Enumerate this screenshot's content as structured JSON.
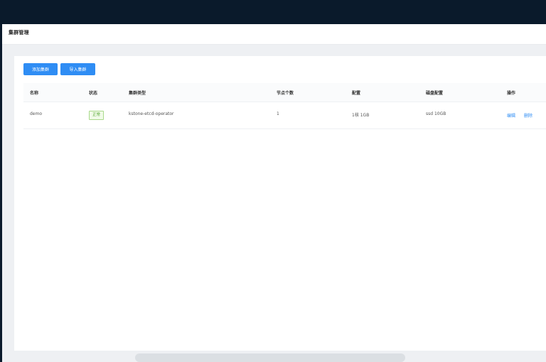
{
  "header": {
    "title": "集群管理"
  },
  "toolbar": {
    "add_label": "添加集群",
    "import_label": "导入集群"
  },
  "table": {
    "columns": [
      "名称",
      "状态",
      "集群类型",
      "节点个数",
      "配置",
      "磁盘配置",
      "操作"
    ],
    "rows": [
      {
        "name": "demo",
        "status": "正常",
        "type": "kstone-etcd-operator",
        "nodes": "1",
        "config": "1核 1GB",
        "disk": "ssd 10GB",
        "actions": [
          "编辑",
          "删除"
        ]
      }
    ]
  },
  "colors": {
    "primary": "#2f8df4",
    "success": "#55a532",
    "frame": "#0b1a2c"
  }
}
